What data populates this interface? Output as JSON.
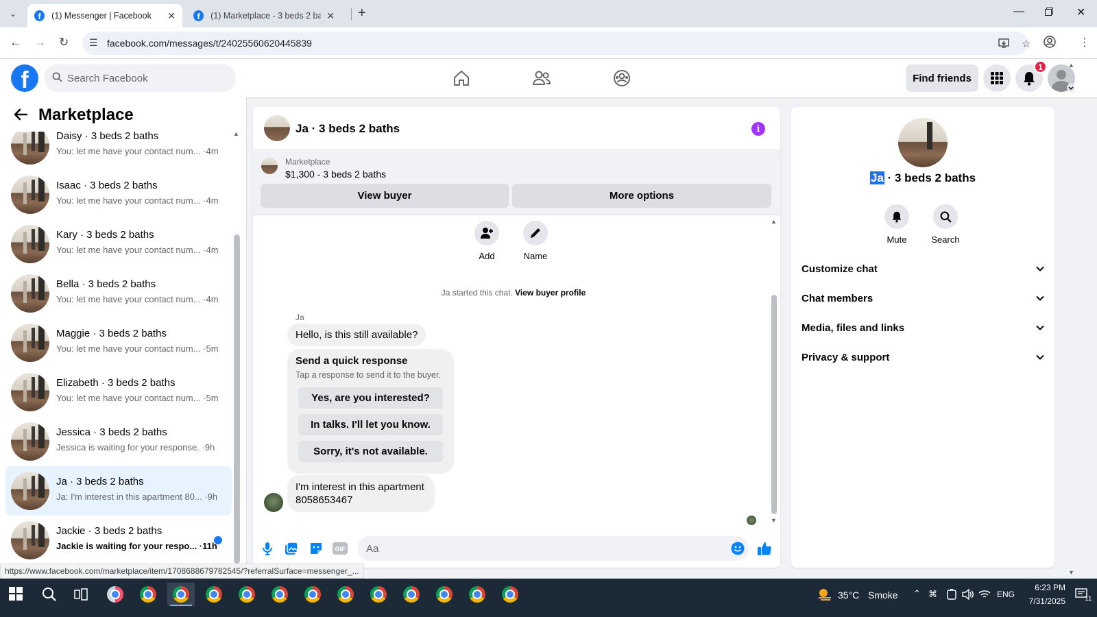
{
  "browser": {
    "tabs": [
      {
        "title": "(1) Messenger | Facebook",
        "active": true
      },
      {
        "title": "(1) Marketplace - 3 beds 2 baths",
        "active": false
      }
    ],
    "url": "facebook.com/messages/t/24025560620445839",
    "status_url": "https://www.facebook.com/marketplace/item/1708688679782545/?referralSurface=messenger_..."
  },
  "fb_header": {
    "logo_letter": "f",
    "search_placeholder": "Search Facebook",
    "find_friends_label": "Find friends",
    "notification_count": "1",
    "brand_color": "#1877f2"
  },
  "sidebar": {
    "title": "Marketplace",
    "conversations": [
      {
        "name": "Daisy · 3 beds 2 baths",
        "snippet": "You: let me have your contact num... ·4m",
        "unread": false
      },
      {
        "name": "Isaac · 3 beds 2 baths",
        "snippet": "You: let me have your contact num... ·4m",
        "unread": false
      },
      {
        "name": "Kary · 3 beds 2 baths",
        "snippet": "You: let me have your contact num... ·4m",
        "unread": false
      },
      {
        "name": "Bella · 3 beds 2 baths",
        "snippet": "You: let me have your contact num... ·4m",
        "unread": false
      },
      {
        "name": "Maggie · 3 beds 2 baths",
        "snippet": "You: let me have your contact num... ·5m",
        "unread": false
      },
      {
        "name": "Elizabeth · 3 beds 2 baths",
        "snippet": "You: let me have your contact num... ·5m",
        "unread": false
      },
      {
        "name": "Jessica · 3 beds 2 baths",
        "snippet": "Jessica is waiting for your response. ·9h",
        "unread": false
      },
      {
        "name": "Ja · 3 beds 2 baths",
        "snippet": "Ja: I'm interest in this apartment 80... ·9h",
        "unread": false,
        "selected": true
      },
      {
        "name": "Jackie · 3 beds 2 baths",
        "snippet": "Jackie is waiting for your respo... ·11h",
        "unread": true
      }
    ]
  },
  "chat": {
    "title": "Ja · 3 beds 2 baths",
    "marketplace_label": "Marketplace",
    "listing": "$1,300 - 3 beds 2 baths",
    "view_buyer_label": "View buyer",
    "more_options_label": "More options",
    "add_label": "Add",
    "name_label": "Name",
    "started_text": "Ja started this chat.",
    "view_buyer_profile_label": "View buyer profile",
    "sender_name": "Ja",
    "message_1": "Hello, is this still available?",
    "quick_response_title": "Send a quick response",
    "quick_response_sub": "Tap a response to send it to the buyer.",
    "quick_responses": [
      "Yes, are you interested?",
      "In talks. I'll let you know.",
      "Sorry, it's not available."
    ],
    "message_2_line1": "I'm interest in this apartment",
    "message_2_line2": "8058653467",
    "composer_placeholder": "Aa",
    "accent_color": "#0084ff"
  },
  "info_panel": {
    "name_highlight": "Ja",
    "name_rest": "· 3 beds 2 baths",
    "mute_label": "Mute",
    "search_label": "Search",
    "sections": [
      "Customize chat",
      "Chat members",
      "Media, files and links",
      "Privacy & support"
    ]
  },
  "taskbar": {
    "weather_temp": "35°C",
    "weather_text": "Smoke",
    "language": "ENG",
    "time": "6:23 PM",
    "date": "7/31/2025",
    "notification_count": "11"
  }
}
